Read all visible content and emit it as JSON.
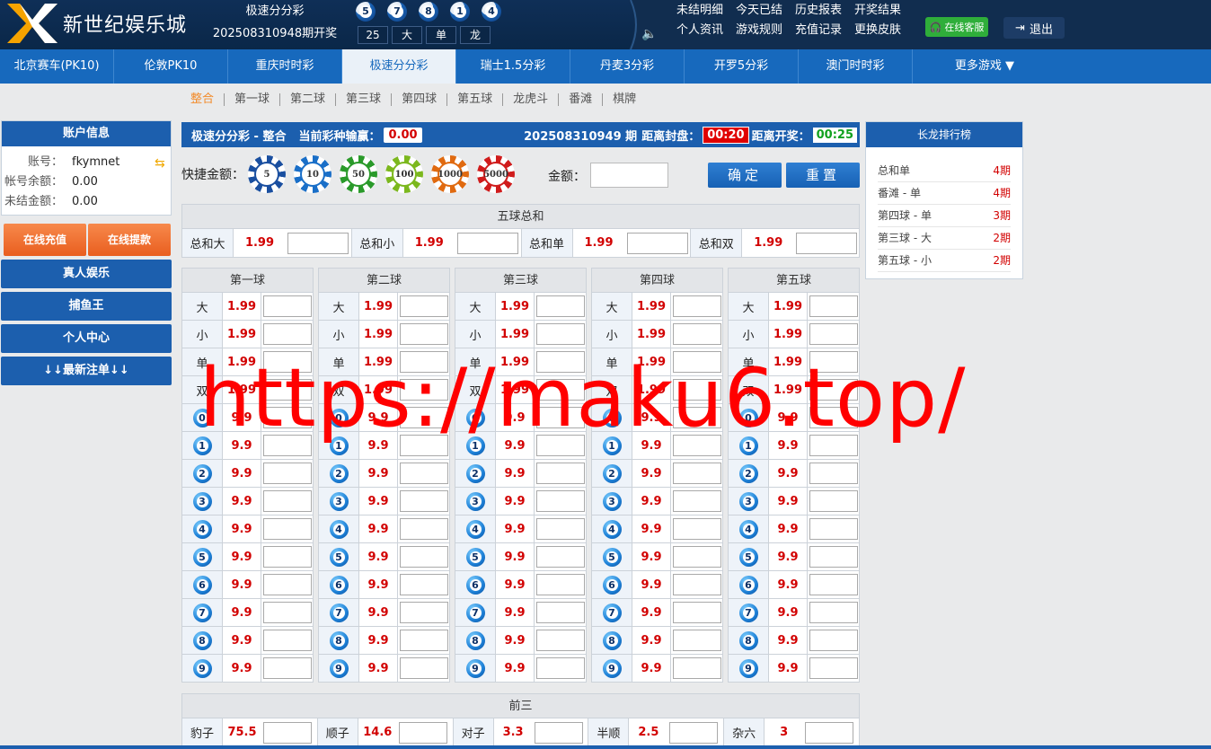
{
  "header": {
    "logo_text": "新世纪娱乐城",
    "game_name": "极速分分彩",
    "period_text": "202508310948期开奖",
    "balls": [
      "5",
      "7",
      "8",
      "1",
      "4"
    ],
    "stats": [
      "25",
      "大",
      "单",
      "龙"
    ],
    "links": [
      "未结明细",
      "今天已结",
      "历史报表",
      "开奖结果",
      "个人资讯",
      "游戏规则",
      "充值记录",
      "更换皮肤"
    ],
    "kefu": "在线客服",
    "logout": "退出"
  },
  "nav": {
    "tabs": [
      "北京赛车(PK10)",
      "伦敦PK10",
      "重庆时时彩",
      "极速分分彩",
      "瑞士1.5分彩",
      "丹麦3分彩",
      "开罗5分彩",
      "澳门时时彩"
    ],
    "active_index": 3,
    "more": "更多游戏 ▼"
  },
  "subtabs": {
    "items": [
      "整合",
      "第一球",
      "第二球",
      "第三球",
      "第四球",
      "第五球",
      "龙虎斗",
      "番滩",
      "棋牌"
    ],
    "active_index": 0
  },
  "account": {
    "title": "账户信息",
    "username_label": "账号：",
    "username": "fkymnet",
    "balance_label": "帐号余额：",
    "balance": "0.00",
    "unsettled_label": "未结金额：",
    "unsettled": "0.00",
    "recharge": "在线充值",
    "withdraw": "在线提款",
    "menu": [
      "真人娱乐",
      "捕鱼王",
      "个人中心",
      "↓↓最新注单↓↓"
    ]
  },
  "main": {
    "title": "极速分分彩 - 整合",
    "winloss_label": "当前彩种输赢：",
    "winloss": "0.00",
    "period": "202508310949 期",
    "close_label": "距离封盘：",
    "close_time": "00:20",
    "open_label": "距离开奖：",
    "open_time": "00:25",
    "quick_label": "快捷金额：",
    "chips": [
      "5",
      "10",
      "50",
      "100",
      "1000",
      "5000"
    ],
    "amount_label": "金额：",
    "confirm": "确定",
    "reset": "重置"
  },
  "sum": {
    "title": "五球总和",
    "items": [
      {
        "label": "总和大",
        "odds": "1.99"
      },
      {
        "label": "总和小",
        "odds": "1.99"
      },
      {
        "label": "总和单",
        "odds": "1.99"
      },
      {
        "label": "总和双",
        "odds": "1.99"
      }
    ]
  },
  "balls": {
    "columns": [
      "第一球",
      "第二球",
      "第三球",
      "第四球",
      "第五球"
    ],
    "text_rows": [
      {
        "label": "大",
        "odds": "1.99"
      },
      {
        "label": "小",
        "odds": "1.99"
      },
      {
        "label": "单",
        "odds": "1.99"
      },
      {
        "label": "双",
        "odds": "1.99"
      }
    ],
    "num_rows": [
      "0",
      "1",
      "2",
      "3",
      "4",
      "5",
      "6",
      "7",
      "8",
      "9"
    ],
    "num_odds": "9.9"
  },
  "front3": {
    "title": "前三",
    "items": [
      {
        "label": "豹子",
        "odds": "75.5"
      },
      {
        "label": "顺子",
        "odds": "14.6"
      },
      {
        "label": "对子",
        "odds": "3.3"
      },
      {
        "label": "半顺",
        "odds": "2.5"
      },
      {
        "label": "杂六",
        "odds": "3"
      }
    ]
  },
  "ranking": {
    "title": "长龙排行榜",
    "items": [
      {
        "name": "总和单",
        "count": "4期"
      },
      {
        "name": "番滩 - 单",
        "count": "4期"
      },
      {
        "name": "第四球 - 单",
        "count": "3期"
      },
      {
        "name": "第三球 - 大",
        "count": "2期"
      },
      {
        "name": "第五球 - 小",
        "count": "2期"
      }
    ]
  },
  "watermark": "https://maku6.top/",
  "colors": {
    "primary": "#1c5fae",
    "header": "#0f2f57",
    "odds": "#d20000",
    "orange": "#e95e1f",
    "green": "#11a11f"
  }
}
